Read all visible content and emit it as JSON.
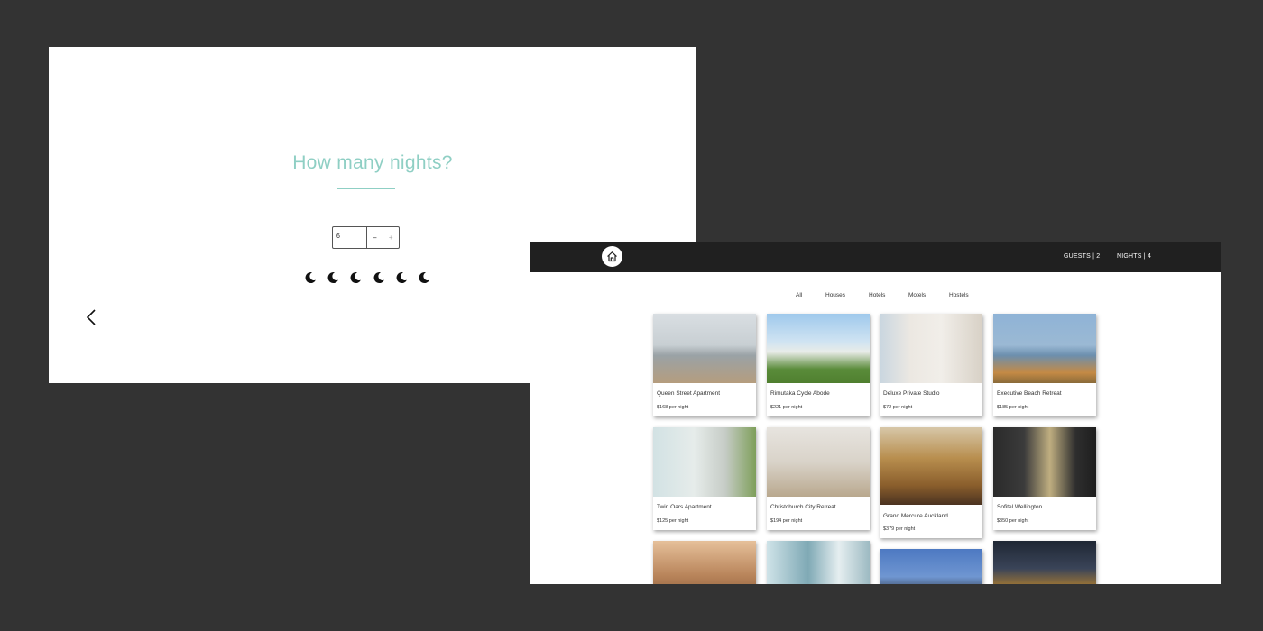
{
  "nights_picker": {
    "title": "How many nights?",
    "stepper": {
      "value": "6",
      "minus_label": "–",
      "plus_label": "+"
    },
    "moon_count": 6,
    "back_icon": "chevron-left-icon",
    "colors": {
      "title": "#8fcfc4",
      "moon": "#111111"
    }
  },
  "listings": {
    "logo_icon": "home-icon",
    "nav": {
      "guests": "GUESTS | 2",
      "nights": "NIGHTS | 4"
    },
    "filters": [
      "All",
      "Houses",
      "Hotels",
      "Motels",
      "Hostels"
    ],
    "cards": [
      {
        "name": "Queen Street Apartment",
        "price": "$168 per night"
      },
      {
        "name": "Rimutaka Cycle Abode",
        "price": "$221 per night"
      },
      {
        "name": "Deluxe Private Studio",
        "price": "$72 per night"
      },
      {
        "name": "Executive Beach Retreat",
        "price": "$185 per night"
      },
      {
        "name": "Twin Oars Apartment",
        "price": "$125 per night"
      },
      {
        "name": "Christchurch City Retreat",
        "price": "$194 per night"
      },
      {
        "name": "Grand Mercure Auckland",
        "price": "$379 per night"
      },
      {
        "name": "Sofitel Wellington",
        "price": "$350 per night"
      },
      {
        "name": "",
        "price": ""
      },
      {
        "name": "",
        "price": ""
      },
      {
        "name": "",
        "price": ""
      },
      {
        "name": "",
        "price": ""
      }
    ],
    "colors": {
      "topbar": "#202020",
      "page_bg": "#333333"
    }
  }
}
